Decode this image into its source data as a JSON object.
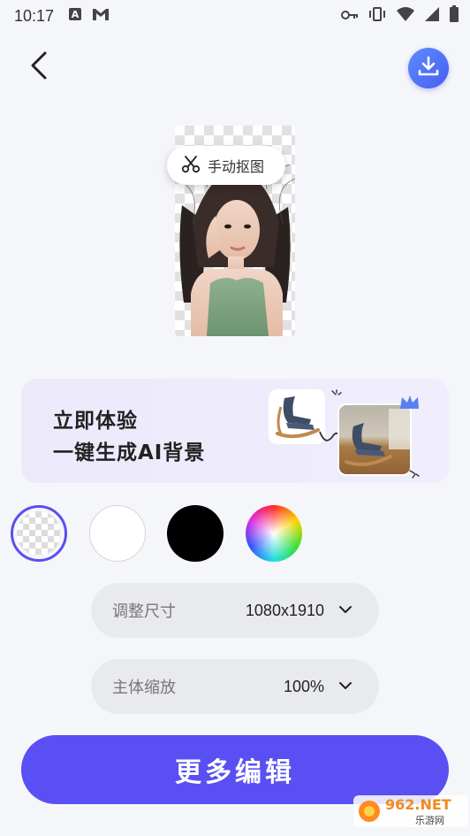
{
  "status_bar": {
    "time": "10:17",
    "left_icons": [
      "a-notification-icon",
      "gmail-icon"
    ],
    "right_icons": [
      "key-icon",
      "vibrate-icon",
      "wifi-icon",
      "signal-icon",
      "battery-icon"
    ]
  },
  "toolbar": {
    "back_icon": "back-arrow-icon",
    "download_icon": "download-icon"
  },
  "preview": {
    "manual_cut_label": "手动抠图",
    "manual_cut_icon": "scissors-icon"
  },
  "ai_banner": {
    "line1": "立即体验",
    "line2": "一键生成AI背景"
  },
  "backgrounds": {
    "options": [
      "transparent",
      "white",
      "black",
      "custom-gradient"
    ],
    "selected": "transparent"
  },
  "settings": {
    "size": {
      "label": "调整尺寸",
      "value": "1080x1910"
    },
    "scale": {
      "label": "主体缩放",
      "value": "100%"
    }
  },
  "actions": {
    "more_edit_label": "更多编辑"
  },
  "colors": {
    "accent": "#5a4ff2",
    "download_gradient": [
      "#5a8dff",
      "#4a5df0"
    ],
    "banner_bg": "#ece9fb"
  },
  "watermark": {
    "text_top": "962.NET",
    "text_bottom": "乐游网"
  }
}
